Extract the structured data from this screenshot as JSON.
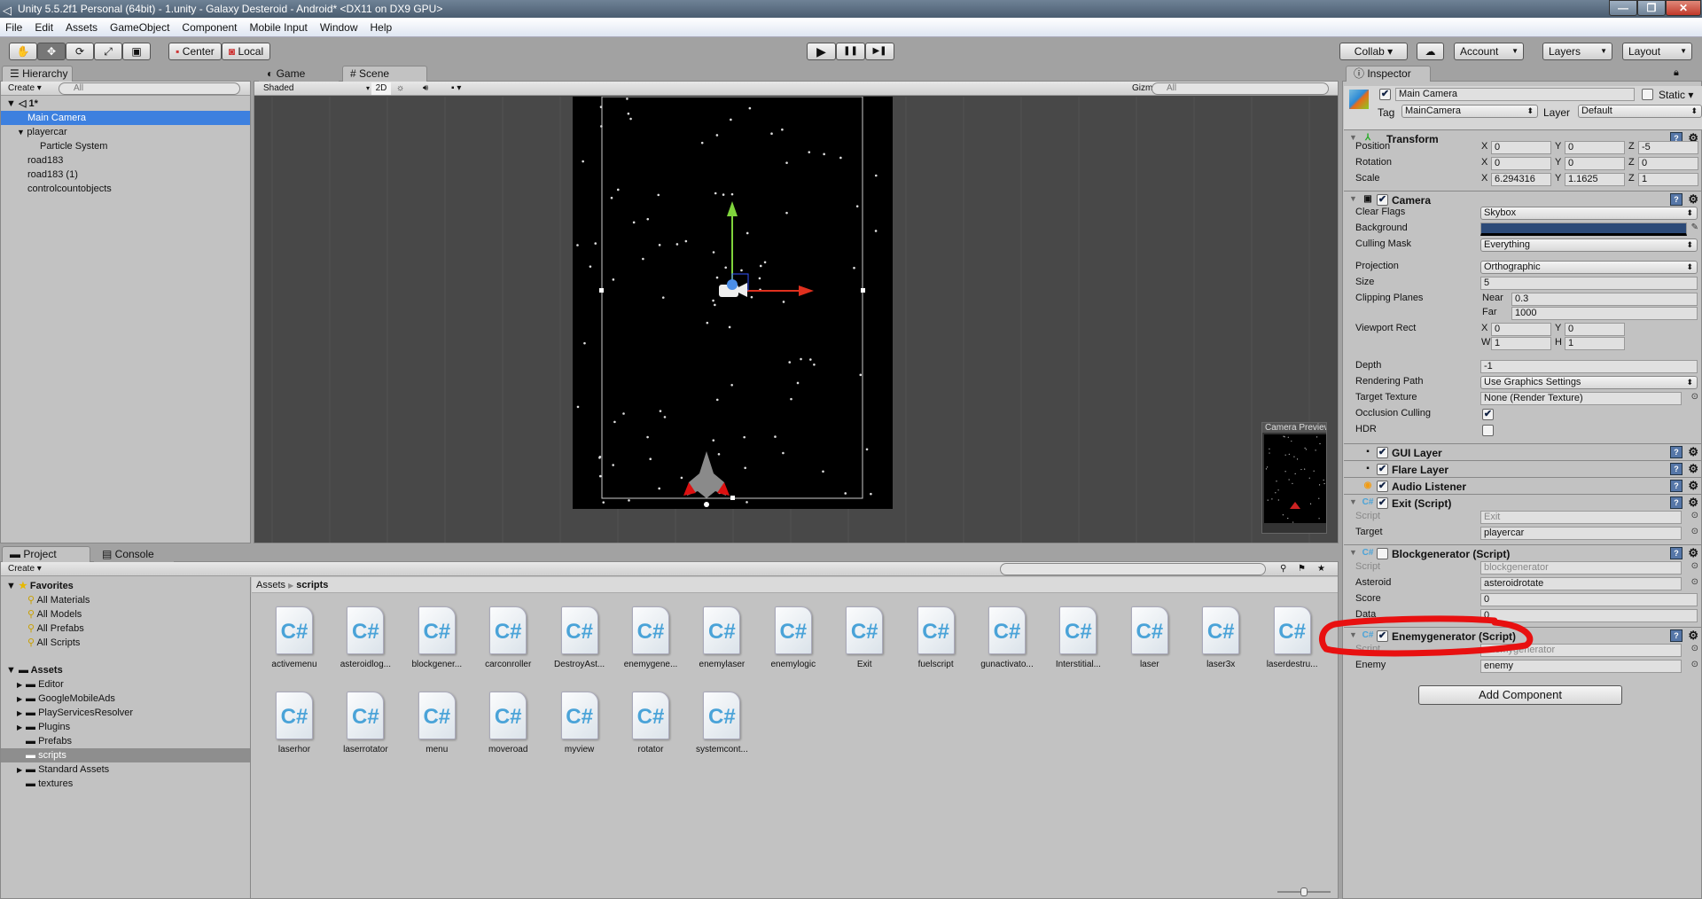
{
  "window": {
    "title": "Unity 5.5.2f1 Personal (64bit) - 1.unity - Galaxy Desteroid - Android* <DX11 on DX9 GPU>",
    "minimize": "—",
    "restore": "❐",
    "close": "✕"
  },
  "menu": [
    "File",
    "Edit",
    "Assets",
    "GameObject",
    "Component",
    "Mobile Input",
    "Window",
    "Help"
  ],
  "toolbar": {
    "tools": [
      "hand-icon",
      "move-icon",
      "rotate-icon",
      "scale-icon",
      "rect-icon"
    ],
    "tool_glyphs": [
      "✋",
      "✥",
      "⟳",
      "⤢",
      "▣"
    ],
    "pivot": "Center",
    "space": "Local",
    "play": "▶",
    "pause": "❚❚",
    "step": "▶❚",
    "collab": "Collab ▾",
    "cloud": "☁",
    "account": "Account",
    "layers": "Layers",
    "layout": "Layout"
  },
  "hierarchy": {
    "tab": "Hierarchy",
    "create": "Create",
    "search_placeholder": "All",
    "scene": "1*",
    "items": [
      {
        "label": "Main Camera",
        "indent": 1,
        "selected": true
      },
      {
        "label": "playercar",
        "indent": 1,
        "expanded": true
      },
      {
        "label": "Particle System",
        "indent": 2
      },
      {
        "label": "road183",
        "indent": 1
      },
      {
        "label": "road183 (1)",
        "indent": 1
      },
      {
        "label": "controlcountobjects",
        "indent": 1
      }
    ]
  },
  "scene": {
    "tabs": [
      "Game",
      "Scene"
    ],
    "active_tab": "Scene",
    "shading": "Shaded",
    "mode_2d": "2D",
    "gizmos": "Gizmos",
    "search_placeholder": "All",
    "camera_preview": "Camera Preview"
  },
  "project": {
    "tabs": [
      "Project",
      "Console"
    ],
    "create": "Create",
    "favorites_label": "Favorites",
    "favorites": [
      "All Materials",
      "All Models",
      "All Prefabs",
      "All Scripts"
    ],
    "assets_label": "Assets",
    "folders": [
      {
        "label": "Editor",
        "expandable": true
      },
      {
        "label": "GoogleMobileAds",
        "expandable": true
      },
      {
        "label": "PlayServicesResolver",
        "expandable": true
      },
      {
        "label": "Plugins",
        "expandable": true
      },
      {
        "label": "Prefabs"
      },
      {
        "label": "scripts",
        "selected": true
      },
      {
        "label": "Standard Assets",
        "expandable": true
      },
      {
        "label": "textures"
      }
    ],
    "breadcrumb": [
      "Assets",
      "scripts"
    ],
    "files": [
      "activemenu",
      "asteroidlog...",
      "blockgener...",
      "carconroller",
      "DestroyAst...",
      "enemygene...",
      "enemylaser",
      "enemylogic",
      "Exit",
      "fuelscript",
      "gunactivato...",
      "Interstitial...",
      "laser",
      "laser3x",
      "laserdestru...",
      "laserhor",
      "laserrotator",
      "menu",
      "moveroad",
      "myview",
      "rotator",
      "systemcont..."
    ]
  },
  "inspector": {
    "tab": "Inspector",
    "name": "Main Camera",
    "static": "Static",
    "tag_label": "Tag",
    "tag": "MainCamera",
    "layer_label": "Layer",
    "layer": "Default",
    "transform": {
      "title": "Transform",
      "position": {
        "label": "Position",
        "x": "0",
        "y": "0",
        "z": "-5"
      },
      "rotation": {
        "label": "Rotation",
        "x": "0",
        "y": "0",
        "z": "0"
      },
      "scale": {
        "label": "Scale",
        "x": "6.294316",
        "y": "1.1625",
        "z": "1"
      }
    },
    "camera": {
      "title": "Camera",
      "clear_flags": [
        "Clear Flags",
        "Skybox"
      ],
      "background": [
        "Background",
        "#2c4a78"
      ],
      "culling_mask": [
        "Culling Mask",
        "Everything"
      ],
      "projection": [
        "Projection",
        "Orthographic"
      ],
      "size": [
        "Size",
        "5"
      ],
      "clipping": {
        "label": "Clipping Planes",
        "near_label": "Near",
        "near": "0.3",
        "far_label": "Far",
        "far": "1000"
      },
      "viewport": {
        "label": "Viewport Rect",
        "x": "0",
        "y": "0",
        "w": "1",
        "h": "1"
      },
      "depth": [
        "Depth",
        "-1"
      ],
      "rendering_path": [
        "Rendering Path",
        "Use Graphics Settings"
      ],
      "target_texture": [
        "Target Texture",
        "None (Render Texture)"
      ],
      "occlusion": [
        "Occlusion Culling",
        true
      ],
      "hdr": [
        "HDR",
        false
      ]
    },
    "gui_layer": "GUI Layer",
    "flare_layer": "Flare Layer",
    "audio_listener": "Audio Listener",
    "exit": {
      "title": "Exit (Script)",
      "script_label": "Script",
      "script": "Exit",
      "target_label": "Target",
      "target": "playercar"
    },
    "blockgen": {
      "title": "Blockgenerator (Script)",
      "enabled": false,
      "script_label": "Script",
      "script": "blockgenerator",
      "asteroid_label": "Asteroid",
      "asteroid": "asteroidrotate",
      "score_label": "Score",
      "score": "0",
      "data_label": "Data",
      "data": "0"
    },
    "enemygen": {
      "title": "Enemygenerator (Script)",
      "script_label": "Script",
      "script": "enemygenerator",
      "enemy_label": "Enemy",
      "enemy": "enemy"
    },
    "add_component": "Add Component"
  },
  "annotation_color": "#e81010"
}
